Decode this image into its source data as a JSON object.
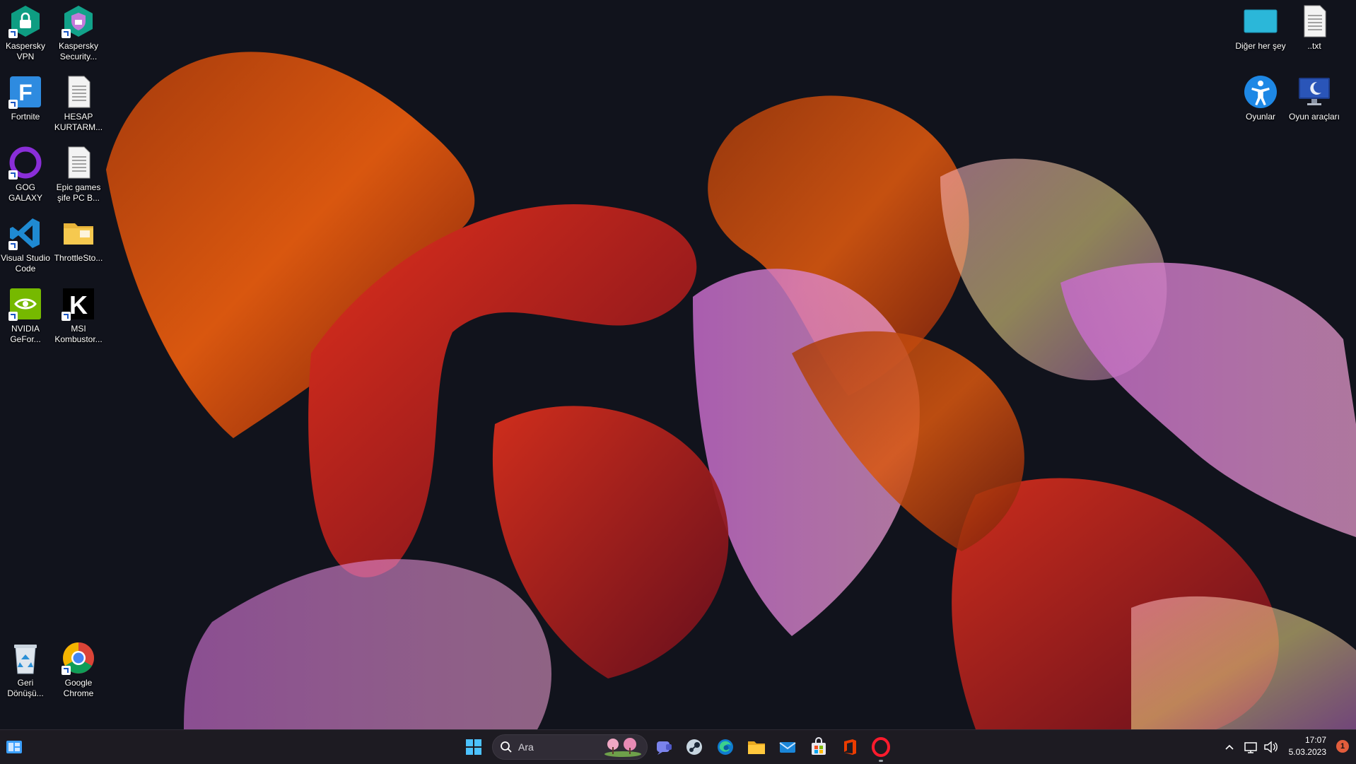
{
  "desktop": {
    "icons_left": [
      {
        "label": "Kaspersky VPN",
        "icon": "kaspersky-vpn-icon"
      },
      {
        "label": "Kaspersky Security...",
        "icon": "kaspersky-security-icon"
      },
      {
        "label": "Fortnite",
        "icon": "fortnite-icon"
      },
      {
        "label": "HESAP KURTARM...",
        "icon": "text-file-icon"
      },
      {
        "label": "GOG GALAXY",
        "icon": "gog-galaxy-icon"
      },
      {
        "label": "Epic games şife PC B...",
        "icon": "text-file-icon"
      },
      {
        "label": "Visual Studio Code",
        "icon": "vscode-icon"
      },
      {
        "label": "ThrottleSto...",
        "icon": "folder-icon"
      },
      {
        "label": "NVIDIA GeFor...",
        "icon": "nvidia-icon"
      },
      {
        "label": "MSI Kombustor...",
        "icon": "msi-kombustor-icon"
      },
      {
        "label": "Geri Dönüşü...",
        "icon": "recycle-bin-icon"
      },
      {
        "label": "Google Chrome",
        "icon": "chrome-icon"
      }
    ],
    "icons_right": [
      {
        "label": "Diğer her şey",
        "icon": "monitor-icon"
      },
      {
        "label": "..txt",
        "icon": "text-file-icon"
      },
      {
        "label": "Oyunlar",
        "icon": "accessibility-icon"
      },
      {
        "label": "Oyun araçları",
        "icon": "display-moon-icon"
      }
    ]
  },
  "taskbar": {
    "search_placeholder": "Ara",
    "pinned": [
      "start-icon",
      "search-icon",
      "teams-chat-icon",
      "steam-icon",
      "edge-icon",
      "file-explorer-icon",
      "mail-icon",
      "store-icon",
      "office-icon",
      "opera-icon"
    ],
    "tray": {
      "time": "17:07",
      "date": "5.03.2023",
      "notification_count": "1"
    }
  },
  "colors": {
    "taskbar_bg": "#1d1b22",
    "accent": "#e35d3c",
    "desktop_bg": "#11131c"
  }
}
